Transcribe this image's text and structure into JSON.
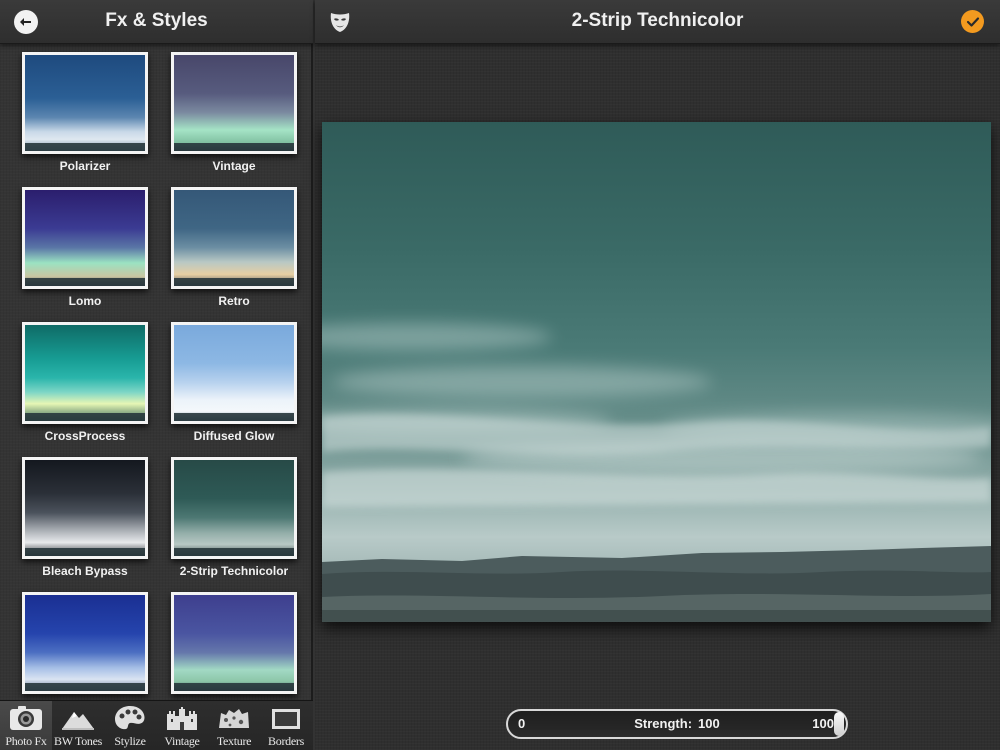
{
  "sidebar": {
    "title": "Fx & Styles",
    "effects": [
      {
        "label": "Polarizer",
        "swatch": "t-polarizer"
      },
      {
        "label": "Vintage",
        "swatch": "t-vintage"
      },
      {
        "label": "Lomo",
        "swatch": "t-lomo"
      },
      {
        "label": "Retro",
        "swatch": "t-retro"
      },
      {
        "label": "CrossProcess",
        "swatch": "t-cross"
      },
      {
        "label": "Diffused Glow",
        "swatch": "t-diffused"
      },
      {
        "label": "Bleach Bypass",
        "swatch": "t-bleach"
      },
      {
        "label": "2-Strip Technicolor",
        "swatch": "t-technicolor"
      },
      {
        "label": "",
        "swatch": "t-blue7"
      },
      {
        "label": "",
        "swatch": "t-purple8"
      }
    ]
  },
  "tabs": [
    {
      "label": "Photo Fx",
      "icon": "camera-icon",
      "active": true
    },
    {
      "label": "BW Tones",
      "icon": "mountain-icon",
      "active": false
    },
    {
      "label": "Stylize",
      "icon": "palette-icon",
      "active": false
    },
    {
      "label": "Vintage",
      "icon": "castle-icon",
      "active": false
    },
    {
      "label": "Texture",
      "icon": "texture-icon",
      "active": false
    },
    {
      "label": "Borders",
      "icon": "frame-icon",
      "active": false
    }
  ],
  "main": {
    "title": "2-Strip Technicolor"
  },
  "slider": {
    "min_label": "0",
    "caption": "Strength:",
    "value": 100,
    "value_label": "100",
    "max_label": "100",
    "min": 0,
    "max": 100
  },
  "colors": {
    "accent": "#f39a1f",
    "header": "#333333"
  }
}
